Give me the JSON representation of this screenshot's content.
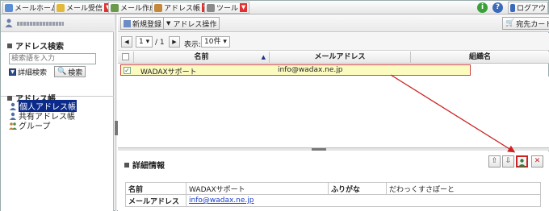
{
  "menubar": {
    "items": [
      {
        "label": "メールホーム"
      },
      {
        "label": "メール受信"
      },
      {
        "label": "メール作成"
      },
      {
        "label": "アドレス帳"
      },
      {
        "label": "ツール"
      }
    ],
    "logout_label": "ログアウ"
  },
  "left": {
    "search_title": "アドレス検索",
    "search_placeholder": "検索語を入力",
    "advanced_label": "詳細検索",
    "search_button": "検索",
    "addressbook_title": "アドレス帳",
    "tree": [
      {
        "label": "個人アドレス帳"
      },
      {
        "label": "共有アドレス帳"
      },
      {
        "label": "グループ"
      }
    ]
  },
  "toolbar": {
    "new_label": "新規登録",
    "ops_label": "アドレス操作",
    "card_label": "宛先カート"
  },
  "pager": {
    "page": "1",
    "total": "/ 1",
    "display_label": "表示:",
    "per_page": "10件"
  },
  "table": {
    "headers": [
      "名前",
      "メールアドレス",
      "組織名"
    ],
    "rows": [
      {
        "name": "WADAXサポート",
        "email": "info@wadax.ne.jp",
        "org": ""
      }
    ]
  },
  "detail": {
    "title": "詳細情報",
    "rows": [
      {
        "label1": "名前",
        "value1": "WADAXサポート",
        "label2": "ふりがな",
        "value2": "だわっくすさぽーと"
      },
      {
        "label1": "メールアドレス",
        "value1": "info@wadax.ne.jp"
      }
    ]
  },
  "colors": {
    "accent_red": "#cc2222",
    "selected_row": "#fbfbc0",
    "selection_blue": "#0b2a8a"
  }
}
